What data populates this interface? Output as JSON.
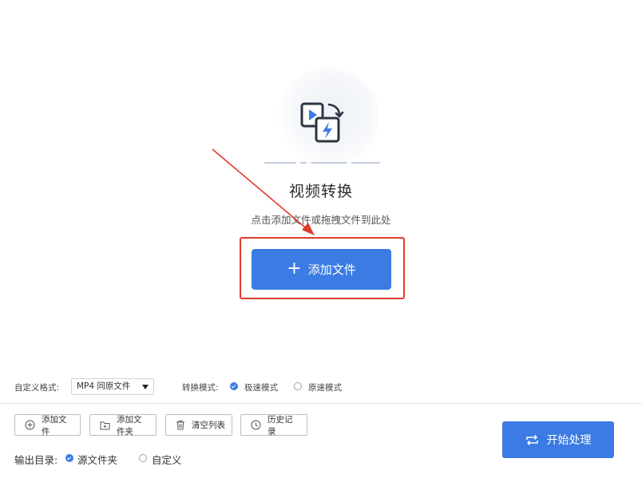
{
  "dropzone": {
    "title": "视频转换",
    "hint": "点击添加文件或拖拽文件到此处",
    "add_button_label": "添加文件",
    "add_button_icon": "plus-icon",
    "hero_icon": "video-convert-icon"
  },
  "settings": {
    "format_label": "自定义格式:",
    "format_value": "MP4 同原文件",
    "mode_label": "转换模式:",
    "modes": [
      {
        "label": "极速模式",
        "selected": true
      },
      {
        "label": "原速模式",
        "selected": false
      }
    ]
  },
  "toolbar": {
    "add_file": "添加文件",
    "add_folder": "添加文件夹",
    "clear_list": "清空列表",
    "history": "历史记录",
    "start": "开始处理"
  },
  "output": {
    "label": "输出目录:",
    "options": [
      {
        "label": "源文件夹",
        "selected": true
      },
      {
        "label": "自定义",
        "selected": false
      }
    ]
  },
  "colors": {
    "accent": "#3b7be3",
    "highlight": "#e03a2c"
  }
}
